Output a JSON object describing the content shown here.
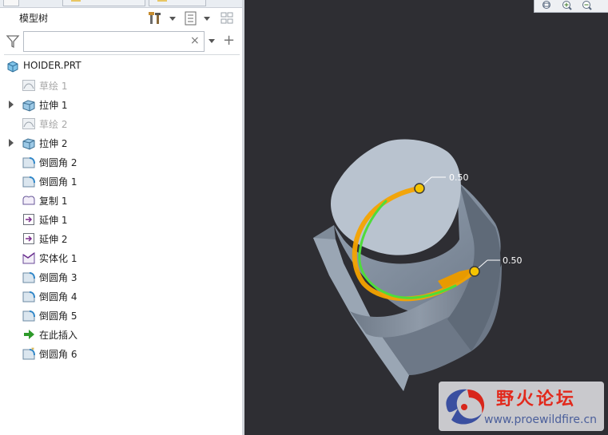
{
  "model_tree": {
    "title": "模型树",
    "search_value": "",
    "clear_symbol": "×",
    "add_symbol": "+",
    "items": [
      {
        "label": "HOIDER.PRT",
        "icon": "part-icon",
        "root": true,
        "expandable": false,
        "dimmed": false
      },
      {
        "label": "草绘 1",
        "icon": "sketch-icon",
        "root": false,
        "expandable": false,
        "dimmed": true
      },
      {
        "label": "拉伸 1",
        "icon": "extrude-icon",
        "root": false,
        "expandable": true,
        "dimmed": false
      },
      {
        "label": "草绘 2",
        "icon": "sketch-icon",
        "root": false,
        "expandable": false,
        "dimmed": true
      },
      {
        "label": "拉伸 2",
        "icon": "extrude-icon",
        "root": false,
        "expandable": true,
        "dimmed": false
      },
      {
        "label": "倒圆角 2",
        "icon": "round-icon",
        "root": false,
        "expandable": false,
        "dimmed": false
      },
      {
        "label": "倒圆角 1",
        "icon": "round-icon",
        "root": false,
        "expandable": false,
        "dimmed": false
      },
      {
        "label": "复制 1",
        "icon": "copy-surface-icon",
        "root": false,
        "expandable": false,
        "dimmed": false
      },
      {
        "label": "延伸 1",
        "icon": "extend-icon",
        "root": false,
        "expandable": false,
        "dimmed": false
      },
      {
        "label": "延伸 2",
        "icon": "extend-icon",
        "root": false,
        "expandable": false,
        "dimmed": false
      },
      {
        "label": "实体化 1",
        "icon": "solidify-icon",
        "root": false,
        "expandable": false,
        "dimmed": false
      },
      {
        "label": "倒圆角 3",
        "icon": "round-icon",
        "root": false,
        "expandable": false,
        "dimmed": false
      },
      {
        "label": "倒圆角 4",
        "icon": "round-icon",
        "root": false,
        "expandable": false,
        "dimmed": false
      },
      {
        "label": "倒圆角 5",
        "icon": "round-icon",
        "root": false,
        "expandable": false,
        "dimmed": false
      },
      {
        "label": "在此插入",
        "icon": "insert-here-arrow-icon",
        "root": false,
        "expandable": false,
        "dimmed": false
      },
      {
        "label": "倒圆角 6",
        "icon": "round-active-icon",
        "root": false,
        "expandable": false,
        "dimmed": false
      }
    ]
  },
  "viewport": {
    "dimensions": [
      "0.50",
      "0.50"
    ]
  },
  "watermark": {
    "title": "野火论坛",
    "url": "www.proewildfire.cn"
  },
  "colors": {
    "viewport_bg": "#2e2e33",
    "part_gray": "#8e98a6",
    "highlight_orange": "#f4a300",
    "highlight_green": "#4fdc3a"
  }
}
